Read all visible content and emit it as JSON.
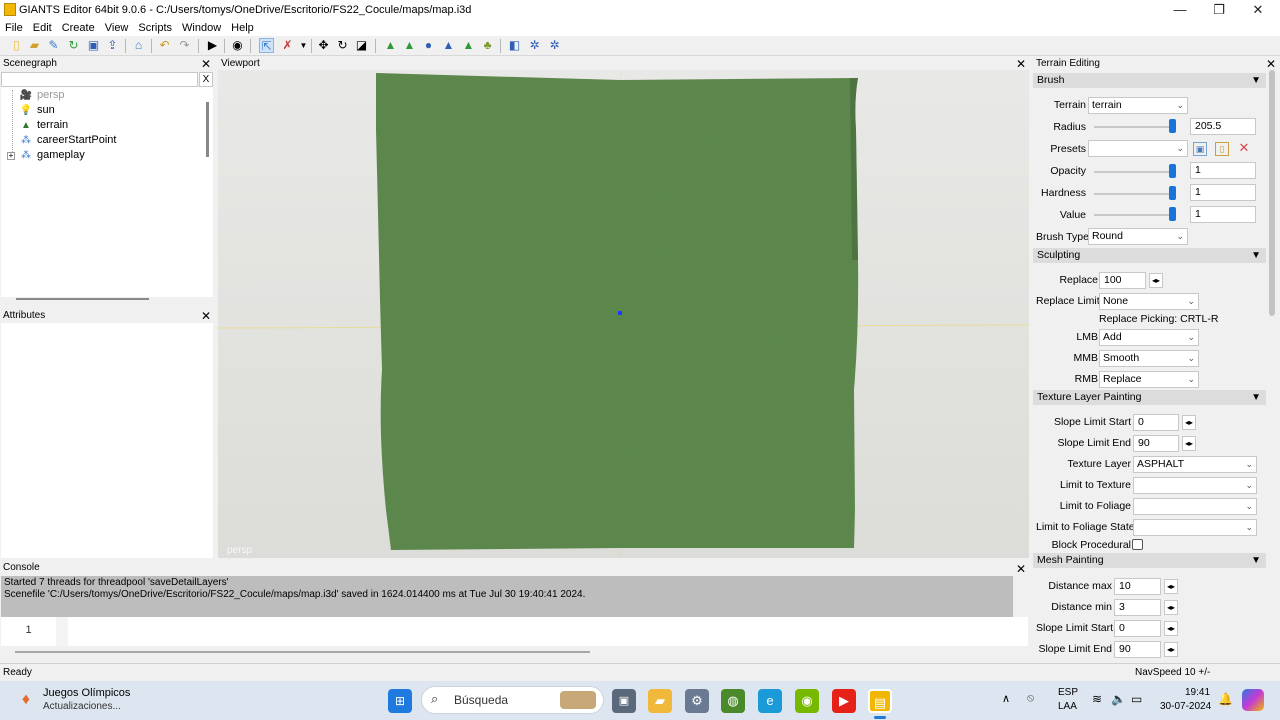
{
  "window": {
    "title": "GIANTS Editor 64bit 9.0.6 - C:/Users/tomys/OneDrive/Escritorio/FS22_Cocule/maps/map.i3d",
    "minimize": "—",
    "maximize": "❐",
    "close": "✕"
  },
  "menu": [
    "File",
    "Edit",
    "Create",
    "View",
    "Scripts",
    "Window",
    "Help"
  ],
  "scenegraph": {
    "title": "Scenegraph",
    "filter_clear": "X",
    "items": [
      {
        "label": "persp",
        "icon": "camera-icon",
        "dim": true
      },
      {
        "label": "sun",
        "icon": "light-icon"
      },
      {
        "label": "terrain",
        "icon": "terrain-icon"
      },
      {
        "label": "careerStartPoint",
        "icon": "transform-group-icon"
      },
      {
        "label": "gameplay",
        "icon": "transform-group-icon",
        "expandable": true
      }
    ]
  },
  "attributes": {
    "title": "Attributes"
  },
  "viewport": {
    "title": "Viewport",
    "camera_label": "persp"
  },
  "console": {
    "title": "Console",
    "lines": [
      "Started 7 threads for threadpool 'saveDetailLayers'",
      "Scenefile 'C:/Users/tomys/OneDrive/Escritorio/FS22_Cocule/maps/map.i3d' saved in 1624.014400 ms at Tue Jul 30 19:40:41 2024."
    ],
    "line_number": "1"
  },
  "terrain_editing": {
    "title": "Terrain Editing",
    "brush": {
      "title": "Brush",
      "terrain_label": "Terrain",
      "terrain_value": "terrain",
      "radius_label": "Radius",
      "radius_value": "205.5",
      "presets_label": "Presets",
      "presets_value": "",
      "opacity_label": "Opacity",
      "opacity_value": "1",
      "hardness_label": "Hardness",
      "hardness_value": "1",
      "value_label": "Value",
      "value_value": "1",
      "brush_type_label": "Brush Type",
      "brush_type_value": "Round",
      "slider_level": 1.0
    },
    "sculpting": {
      "title": "Sculpting",
      "replace_label": "Replace",
      "replace_value": "100",
      "replace_limit_label": "Replace Limit",
      "replace_limit_value": "None",
      "picking_note": "Replace Picking: CRTL-R",
      "lmb_label": "LMB",
      "lmb_value": "Add",
      "mmb_label": "MMB",
      "mmb_value": "Smooth",
      "rmb_label": "RMB",
      "rmb_value": "Replace"
    },
    "texture": {
      "title": "Texture Layer Painting",
      "slope_start_label": "Slope Limit Start",
      "slope_start_value": "0",
      "slope_end_label": "Slope Limit End",
      "slope_end_value": "90",
      "texture_layer_label": "Texture Layer",
      "texture_layer_value": "ASPHALT",
      "limit_texture_label": "Limit to Texture",
      "limit_texture_value": "",
      "limit_foliage_label": "Limit to Foliage",
      "limit_foliage_value": "",
      "limit_foliage_state_label": "Limit to Foliage State",
      "limit_foliage_state_value": "",
      "block_procedural_label": "Block Procedural",
      "block_procedural_checked": false
    },
    "mesh": {
      "title": "Mesh Painting",
      "dist_max_label": "Distance max",
      "dist_max_value": "10",
      "dist_min_label": "Distance min",
      "dist_min_value": "3",
      "slope_start_label": "Slope Limit Start",
      "slope_start_value": "0",
      "slope_end_label": "Slope Limit End",
      "slope_end_value": "90"
    }
  },
  "status": {
    "left": "Ready",
    "right": "NavSpeed 10 +/-"
  },
  "taskbar": {
    "news_title": "Juegos Olímpicos",
    "news_sub": "Actualizaciones...",
    "search": "Búsqueda",
    "lang": "ESP",
    "lang_sub": "LAA",
    "time": "19:41",
    "date": "30-07-2024"
  },
  "colors": {
    "terrain": "#5e8a4e",
    "accent": "#1a73d9",
    "title_bar": "#ffffff"
  }
}
